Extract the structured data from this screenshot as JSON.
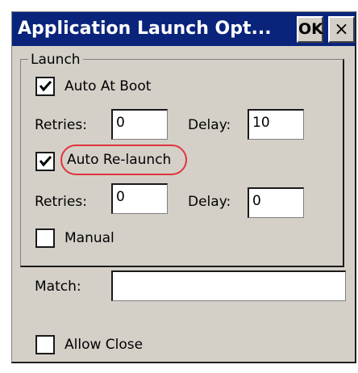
{
  "window": {
    "title": "Application Launch Opt...",
    "ok_label": "OK",
    "close_label": "×"
  },
  "launch_group": {
    "label": "Launch",
    "auto_at_boot": {
      "label": "Auto At Boot",
      "checked": true,
      "retries_label": "Retries:",
      "retries_value": "0",
      "delay_label": "Delay:",
      "delay_value": "10"
    },
    "auto_relaunch": {
      "label": "Auto Re-launch",
      "checked": true,
      "highlighted": true,
      "highlight_color": "#e0343c",
      "retries_label": "Retries:",
      "retries_value": "0",
      "delay_label": "Delay:",
      "delay_value": "0"
    },
    "manual": {
      "label": "Manual",
      "checked": false
    }
  },
  "match": {
    "label": "Match:",
    "value": ""
  },
  "allow_close": {
    "label": "Allow Close",
    "checked": false
  },
  "colors": {
    "titlebar": "#0a247c",
    "dialog_face": "#d4d0c8"
  }
}
